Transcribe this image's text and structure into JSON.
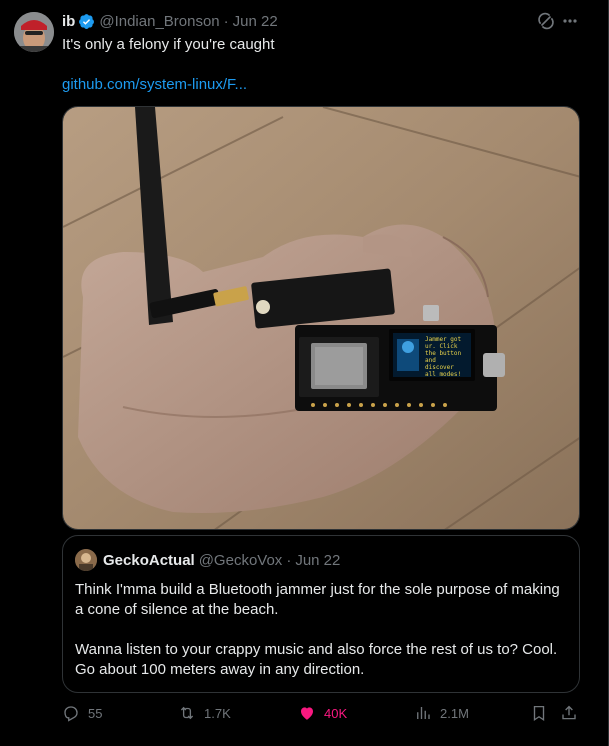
{
  "tweet": {
    "author_name": "ib",
    "author_handle": "@Indian_Bronson",
    "separator": "·",
    "date": "Jun 22",
    "text": "It's only a felony if you're caught",
    "link_text": "github.com/system-linux/F..."
  },
  "media": {
    "oled_text": [
      "Jammer got",
      "ur. Click",
      "the button",
      "and",
      "discover",
      "all modes!"
    ]
  },
  "quote": {
    "author_name": "GeckoActual",
    "author_handle": "@GeckoVox",
    "separator": "·",
    "date": "Jun 22",
    "paragraph1": "Think I'mma build a Bluetooth jammer just for the sole purpose of making a cone of silence at the beach.",
    "paragraph2": "Wanna listen to your crappy music and also force the rest of us to? Cool. Go about 100 meters away in any direction."
  },
  "actions": {
    "replies": "55",
    "reposts": "1.7K",
    "likes": "40K",
    "views": "2.1M"
  },
  "colors": {
    "accent": "#1d9bf0",
    "like": "#f91880",
    "muted": "#71767b"
  },
  "icons": [
    "verified-badge-icon",
    "grok-icon",
    "more-icon",
    "reply-icon",
    "repost-icon",
    "like-icon",
    "views-icon",
    "bookmark-icon",
    "share-icon"
  ]
}
